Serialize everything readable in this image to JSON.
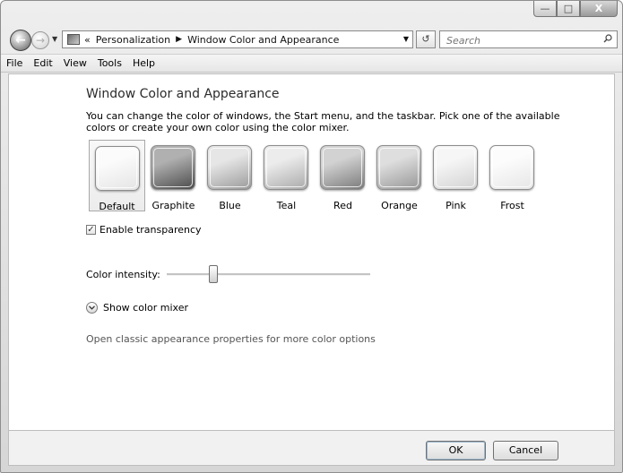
{
  "navigation": {
    "breadcrumb_prefix": "«",
    "breadcrumbs": [
      "Personalization",
      "Window Color and Appearance"
    ],
    "search_placeholder": "Search"
  },
  "menu": {
    "items": [
      "File",
      "Edit",
      "View",
      "Tools",
      "Help"
    ]
  },
  "page": {
    "title": "Window Color and Appearance",
    "description": "You can change the color of windows, the Start menu, and the taskbar. Pick one of the available colors or create your own color using the color mixer."
  },
  "swatches": {
    "selected": "Default",
    "items": [
      {
        "label": "Default",
        "color_top": "#fbfbfb",
        "color_bottom": "#e4e4e4"
      },
      {
        "label": "Graphite",
        "color_top": "#b0b0b0",
        "color_bottom": "#4a4a4a"
      },
      {
        "label": "Blue",
        "color_top": "#e6e6e6",
        "color_bottom": "#9a9a9a"
      },
      {
        "label": "Teal",
        "color_top": "#ececec",
        "color_bottom": "#a9a9a9"
      },
      {
        "label": "Red",
        "color_top": "#d2d2d2",
        "color_bottom": "#7a7a7a"
      },
      {
        "label": "Orange",
        "color_top": "#dedede",
        "color_bottom": "#969696"
      },
      {
        "label": "Pink",
        "color_top": "#f6f6f6",
        "color_bottom": "#d2d2d2"
      },
      {
        "label": "Frost",
        "color_top": "#fcfcfc",
        "color_bottom": "#e6e6e6"
      }
    ]
  },
  "options": {
    "transparency_label": "Enable transparency",
    "transparency_checked": true,
    "intensity_label": "Color intensity:",
    "intensity_value": 0.23,
    "mixer_label": "Show color mixer",
    "classic_link": "Open classic appearance properties for more color options"
  },
  "buttons": {
    "ok": "OK",
    "cancel": "Cancel"
  },
  "window_controls": {
    "minimize": "—",
    "maximize": "□",
    "close": "X"
  }
}
